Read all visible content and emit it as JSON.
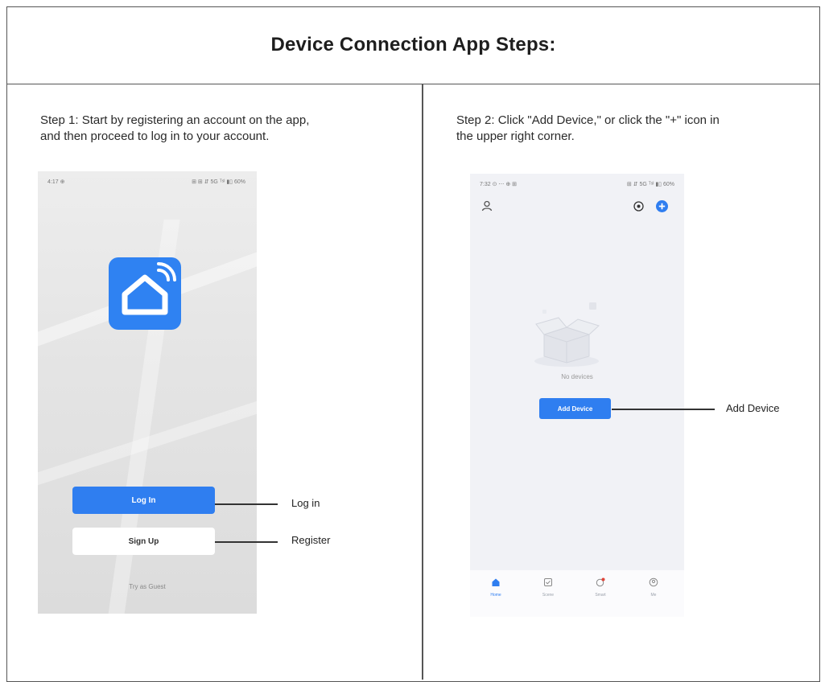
{
  "document": {
    "title": "Device Connection App Steps:"
  },
  "step1": {
    "text_line1": "Step 1: Start by registering an account on the app,",
    "text_line2": "and then proceed to log in to your account.",
    "phone": {
      "status_left": "4:17 ⊕",
      "status_right": "⊞ ⊞ ⇵ 5G ᵀˢᴵ ▮▯ 60%",
      "login_button": "Log In",
      "signup_button": "Sign Up",
      "guest_link": "Try as Guest"
    },
    "callouts": {
      "login": "Log in",
      "register": "Register"
    }
  },
  "step2": {
    "text_line1": "Step 2: Click \"Add Device,\" or click the \"+\" icon in",
    "text_line2": "the upper right corner.",
    "phone": {
      "status_left": "7:32 ⊙ ⋯ ⊕ ⊞",
      "status_right": "⊞ ⇵ 5G ᵀˢᴵ ▮▯ 60%",
      "empty_text": "No devices",
      "add_button": "Add Device",
      "tabs": [
        {
          "label": "Home",
          "icon": "home-icon"
        },
        {
          "label": "Scene",
          "icon": "scene-icon"
        },
        {
          "label": "Smart",
          "icon": "smart-icon"
        },
        {
          "label": "Me",
          "icon": "me-icon"
        }
      ]
    },
    "callouts": {
      "add_device": "Add Device"
    }
  },
  "colors": {
    "accent": "#2f7ef0",
    "border": "#555555"
  }
}
